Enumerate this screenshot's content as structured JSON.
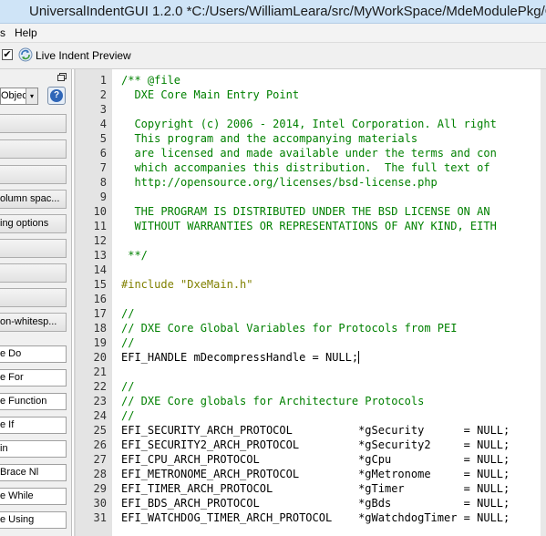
{
  "window": {
    "title": "UniversalIndentGUI 1.2.0 *C:/Users/WilliamLeara/src/MyWorkSpace/MdeModulePkg/Co"
  },
  "menubar": {
    "items": [
      "s",
      "Help"
    ]
  },
  "toolbar": {
    "live_indent_checked": true,
    "live_indent_label": "Live Indent Preview",
    "checkmark": "✔"
  },
  "left_panel": {
    "combo_value": "Objec",
    "combo_arrow": "▾",
    "help_glyph": "?",
    "buttons": [
      "",
      "",
      "",
      "olumn spac...",
      "ing options",
      "",
      "",
      "",
      "on-whitesp..."
    ],
    "fields": [
      "e Do",
      "e For",
      "e Function",
      "e If",
      "in",
      "Brace Nl",
      "e While",
      "e Using"
    ]
  },
  "editor": {
    "lines": [
      {
        "num": "1",
        "text": "/** @file",
        "kind": "comment"
      },
      {
        "num": "2",
        "text": "  DXE Core Main Entry Point",
        "kind": "comment"
      },
      {
        "num": "3",
        "text": "",
        "kind": "comment"
      },
      {
        "num": "4",
        "text": "  Copyright (c) 2006 - 2014, Intel Corporation. All right",
        "kind": "comment"
      },
      {
        "num": "5",
        "text": "  This program and the accompanying materials",
        "kind": "comment"
      },
      {
        "num": "6",
        "text": "  are licensed and made available under the terms and con",
        "kind": "comment"
      },
      {
        "num": "7",
        "text": "  which accompanies this distribution.  The full text of",
        "kind": "comment"
      },
      {
        "num": "8",
        "text": "  http://opensource.org/licenses/bsd-license.php",
        "kind": "comment"
      },
      {
        "num": "9",
        "text": "",
        "kind": "comment"
      },
      {
        "num": "10",
        "text": "  THE PROGRAM IS DISTRIBUTED UNDER THE BSD LICENSE ON AN",
        "kind": "comment"
      },
      {
        "num": "11",
        "text": "  WITHOUT WARRANTIES OR REPRESENTATIONS OF ANY KIND, EITH",
        "kind": "comment"
      },
      {
        "num": "12",
        "text": "",
        "kind": "comment"
      },
      {
        "num": "13",
        "text": " **/",
        "kind": "comment"
      },
      {
        "num": "14",
        "text": "",
        "kind": "normal"
      },
      {
        "num": "15",
        "text": "#include \"DxeMain.h\"",
        "kind": "preproc"
      },
      {
        "num": "16",
        "text": "",
        "kind": "normal"
      },
      {
        "num": "17",
        "text": "//",
        "kind": "comment"
      },
      {
        "num": "18",
        "text": "// DXE Core Global Variables for Protocols from PEI",
        "kind": "comment"
      },
      {
        "num": "19",
        "text": "//",
        "kind": "comment"
      },
      {
        "num": "20",
        "text": "EFI_HANDLE mDecompressHandle = NULL;",
        "kind": "normal",
        "cursor": true
      },
      {
        "num": "21",
        "text": "",
        "kind": "normal"
      },
      {
        "num": "22",
        "text": "//",
        "kind": "comment"
      },
      {
        "num": "23",
        "text": "// DXE Core globals for Architecture Protocols",
        "kind": "comment"
      },
      {
        "num": "24",
        "text": "//",
        "kind": "comment"
      },
      {
        "num": "25",
        "text": "EFI_SECURITY_ARCH_PROTOCOL          *gSecurity      = NULL;",
        "kind": "normal"
      },
      {
        "num": "26",
        "text": "EFI_SECURITY2_ARCH_PROTOCOL         *gSecurity2     = NULL;",
        "kind": "normal"
      },
      {
        "num": "27",
        "text": "EFI_CPU_ARCH_PROTOCOL               *gCpu           = NULL;",
        "kind": "normal"
      },
      {
        "num": "28",
        "text": "EFI_METRONOME_ARCH_PROTOCOL         *gMetronome     = NULL;",
        "kind": "normal"
      },
      {
        "num": "29",
        "text": "EFI_TIMER_ARCH_PROTOCOL             *gTimer         = NULL;",
        "kind": "normal"
      },
      {
        "num": "30",
        "text": "EFI_BDS_ARCH_PROTOCOL               *gBds           = NULL;",
        "kind": "normal"
      },
      {
        "num": "31",
        "text": "EFI_WATCHDOG_TIMER_ARCH_PROTOCOL    *gWatchdogTimer = NULL;",
        "kind": "normal"
      }
    ]
  },
  "colors": {
    "comment": "#008000",
    "preproc": "#808000",
    "gutter": "#e4e4e4",
    "titlebar": "#cfe4f7"
  }
}
